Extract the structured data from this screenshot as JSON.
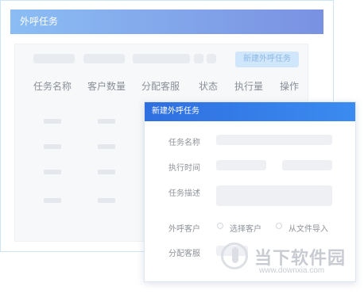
{
  "background_window": {
    "title": "外呼任务",
    "new_task_button": "新建外呼任务",
    "columns": [
      "任务名称",
      "客户数量",
      "分配客服",
      "状态",
      "执行量",
      "操作"
    ]
  },
  "dialog": {
    "title": "新建外呼任务",
    "fields": {
      "task_name_label": "任务名称",
      "exec_time_label": "执行时间",
      "description_label": "任务描述",
      "customer_label": "外呼客户",
      "agent_label": "分配客服"
    },
    "customer_options": {
      "select": "选择客户",
      "import": "从文件导入"
    }
  },
  "watermark": {
    "title": "当下软件园",
    "url": "www.downxia.com"
  }
}
